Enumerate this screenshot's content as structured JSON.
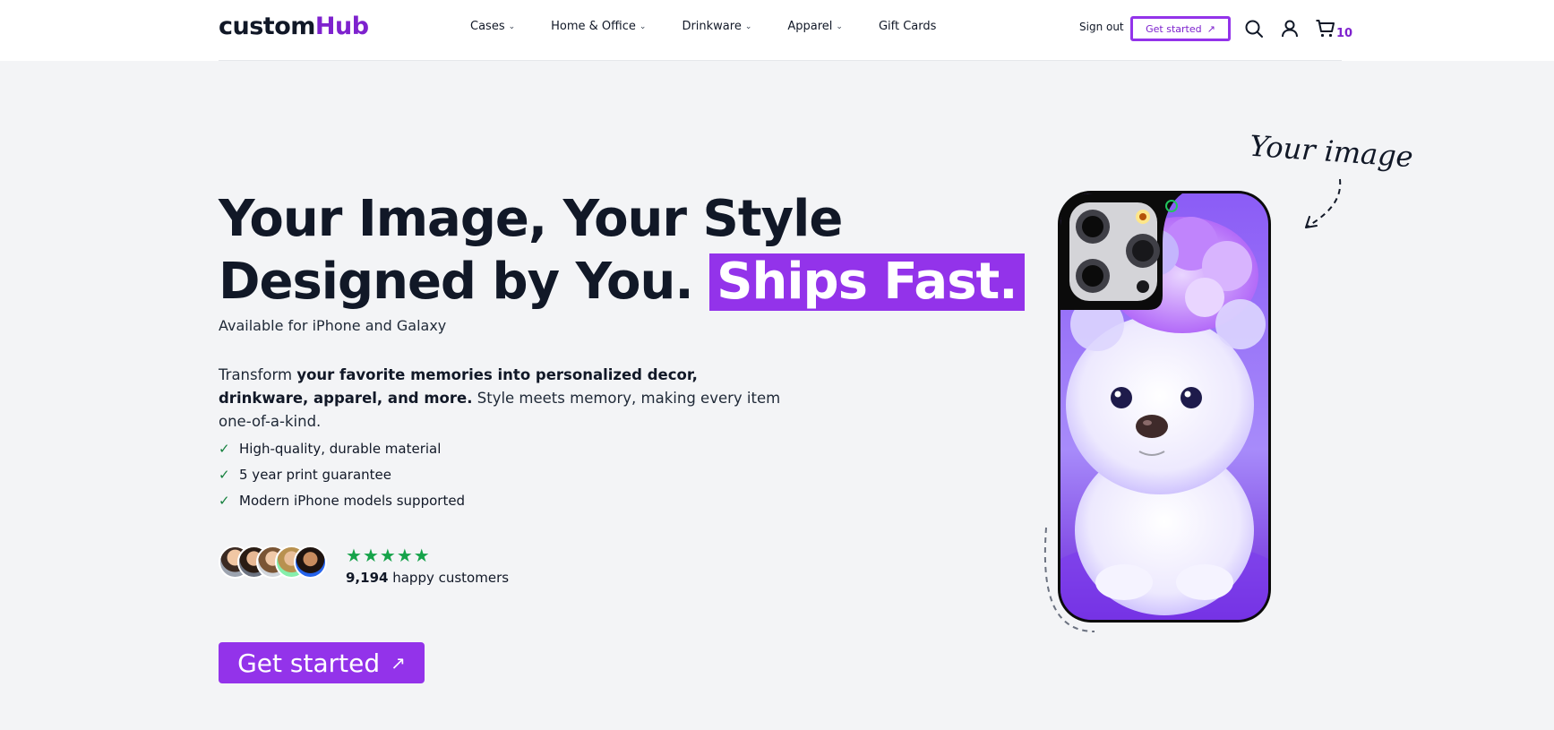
{
  "header": {
    "logo": {
      "part1": "custom",
      "part2": "Hub"
    },
    "nav": [
      {
        "label": "Cases",
        "has_dropdown": true
      },
      {
        "label": "Home & Office",
        "has_dropdown": true
      },
      {
        "label": "Drinkware",
        "has_dropdown": true
      },
      {
        "label": "Apparel",
        "has_dropdown": true
      },
      {
        "label": "Gift Cards",
        "has_dropdown": false
      }
    ],
    "sign_out": "Sign out",
    "get_started": "Get started",
    "cart_count": "10",
    "icons": [
      "search-icon",
      "user-icon",
      "cart-icon"
    ]
  },
  "hero": {
    "title_line1": "Your Image, Your Style",
    "title_line2": "Designed by You.",
    "title_highlight": "Ships Fast.",
    "subtitle": "Available for iPhone and Galaxy",
    "desc_intro": "Transform ",
    "desc_bold": "your favorite memories into personalized decor, drinkware, apparel, and more.",
    "desc_rest": " Style meets memory, making every item one-of-a-kind.",
    "features": [
      "High-quality, durable material",
      "5 year print guarantee",
      "Modern iPhone models supported"
    ],
    "rating_stars": 5,
    "customers_count": "9,194",
    "customers_text": " happy customers",
    "cta": "Get started",
    "annotation": "Your image"
  },
  "colors": {
    "brand": "#9333ea",
    "brand_dark": "#7e22ce",
    "star": "#16a34a",
    "check": "#15803d",
    "background": "#f3f4f6"
  }
}
